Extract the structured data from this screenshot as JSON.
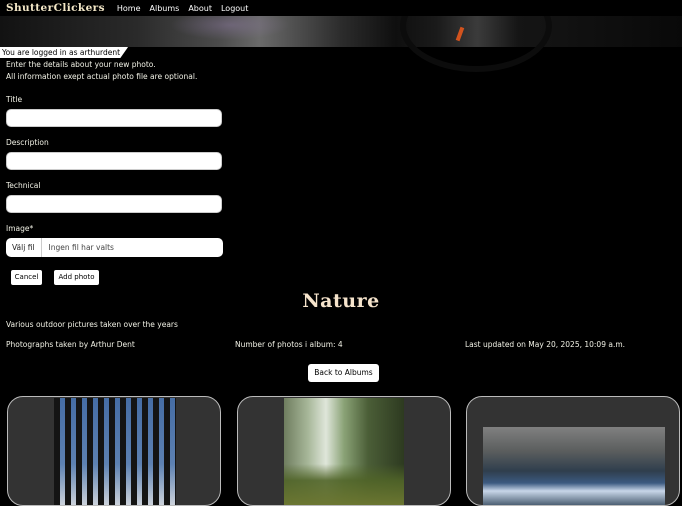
{
  "nav": {
    "brand": "ShutterClickers",
    "links": [
      "Home",
      "Albums",
      "About",
      "Logout"
    ]
  },
  "login_status": "You are logged in as arthurdent",
  "form": {
    "intro_1": "Enter the details about your new photo.",
    "intro_2": "All information exept actual photo file are optional.",
    "title_label": "Title",
    "title_value": "",
    "description_label": "Description",
    "description_value": "",
    "technical_label": "Technical",
    "technical_value": "",
    "image_label": "Image*",
    "file_button": "Välj fil",
    "file_status": "Ingen fil har valts",
    "cancel": "Cancel",
    "add_photo": "Add photo"
  },
  "album": {
    "title": "Nature",
    "description": "Various outdoor pictures taken over the years",
    "photographer": "Photographs taken by Arthur Dent",
    "photo_count": "Number of photos i album: 4",
    "last_updated": "Last updated on May 20, 2025, 10:09 a.m.",
    "back_button": "Back to Albums"
  },
  "photos": [
    {
      "subject": "forest-trees"
    },
    {
      "subject": "forest-clearing"
    },
    {
      "subject": "stream"
    }
  ]
}
